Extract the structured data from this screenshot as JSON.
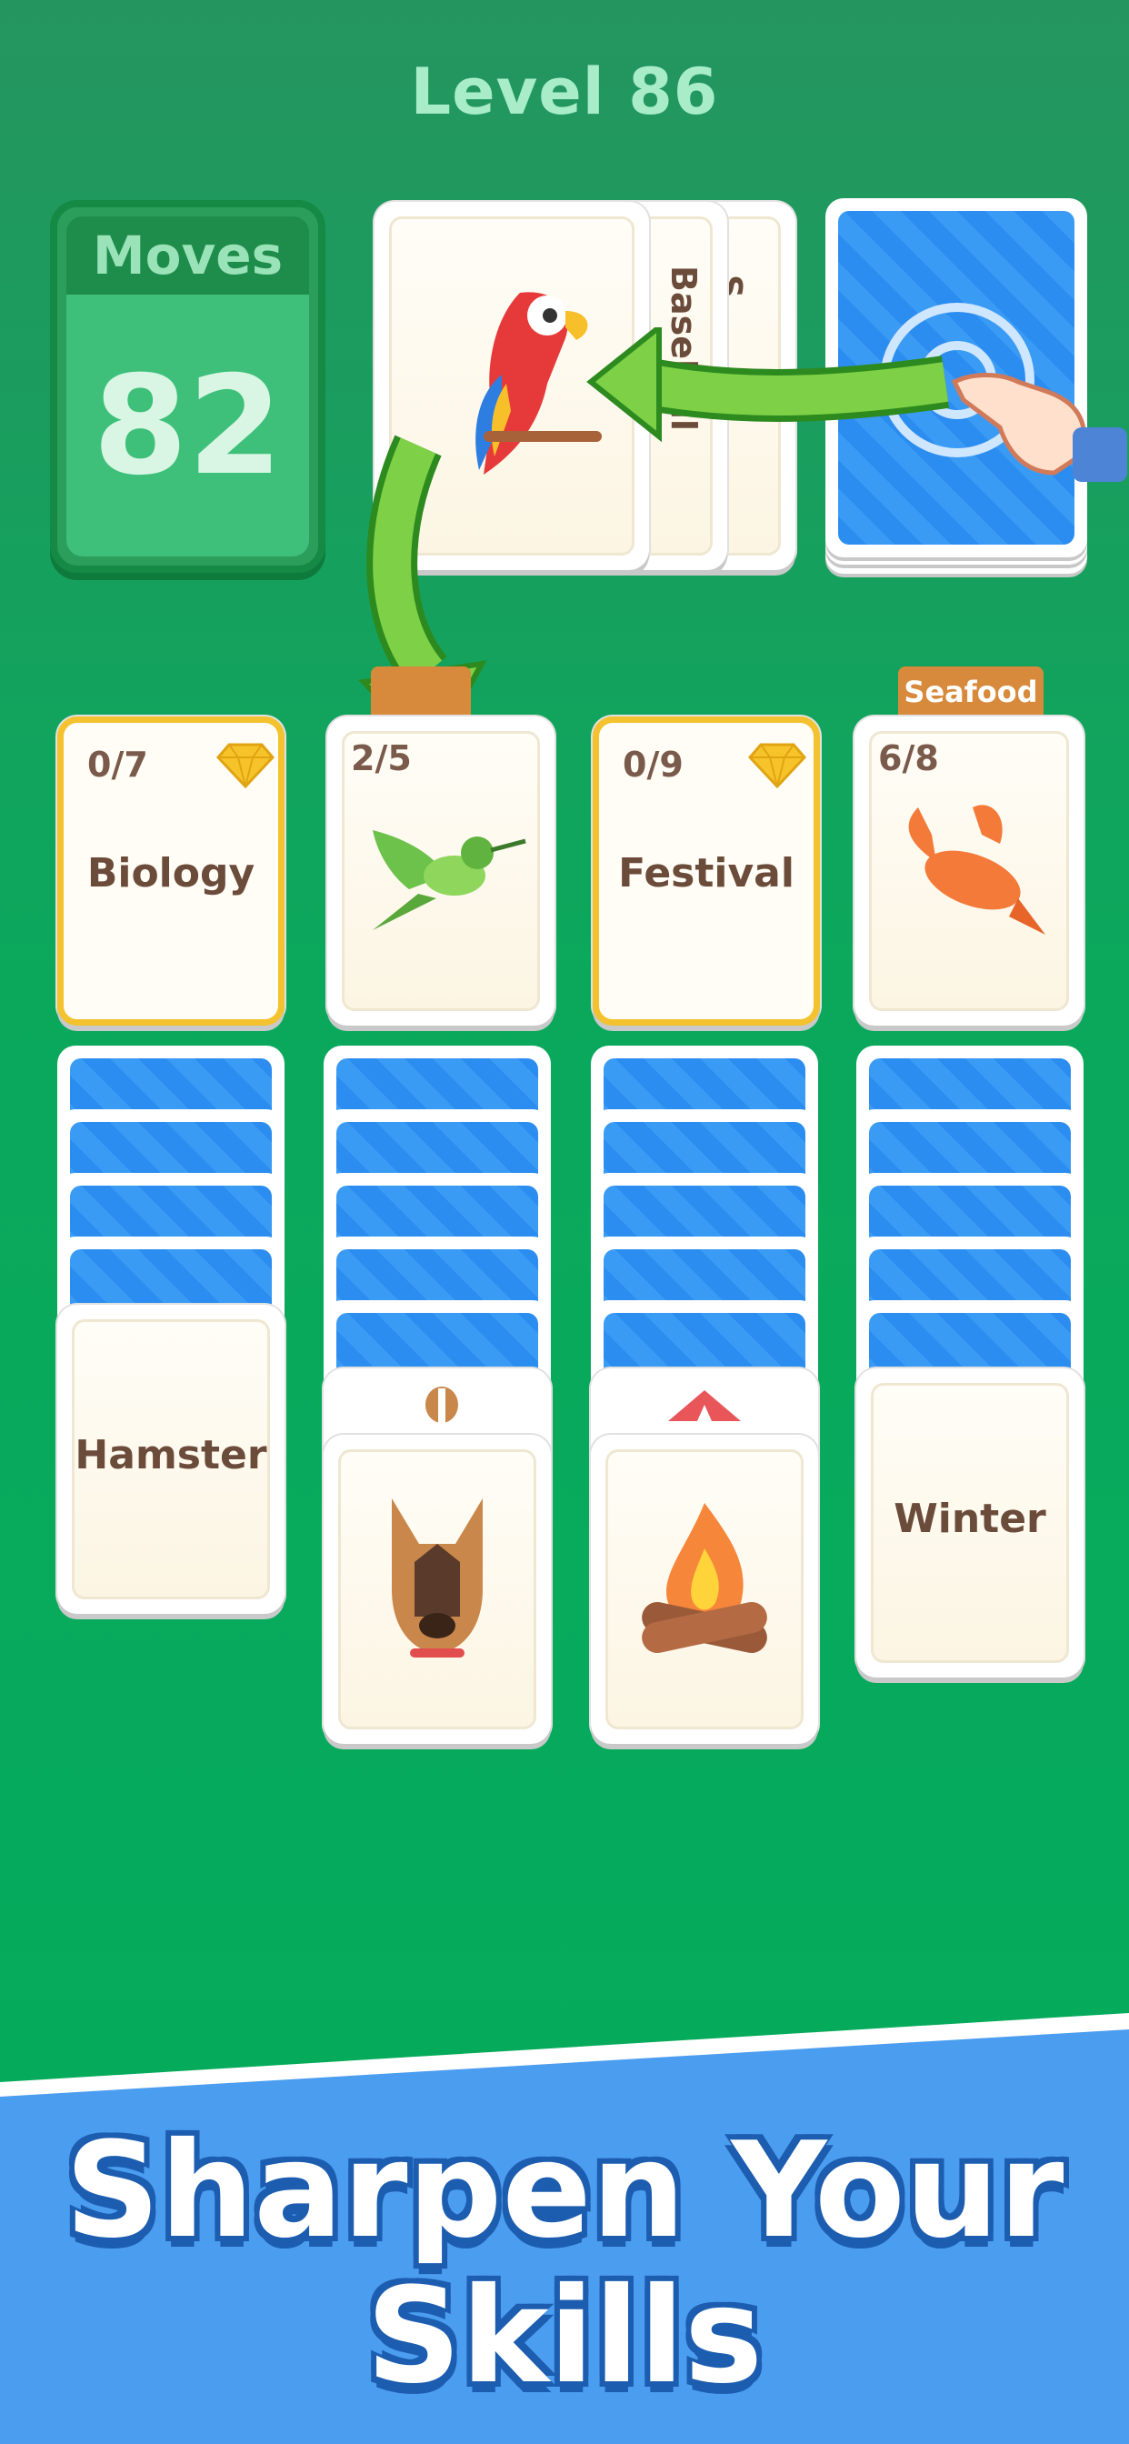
{
  "header": {
    "level_label": "Level 86"
  },
  "moves": {
    "label": "Moves",
    "value": "82"
  },
  "draw_pile": {
    "top_card_icon": "parrot-icon",
    "stacked_labels": [
      "Baseball",
      "S"
    ]
  },
  "deck": {
    "icon": "card-back-target-icon"
  },
  "foundations": [
    {
      "counter": "0/7",
      "title": "Biology",
      "type": "category",
      "gem": true
    },
    {
      "counter": "2/5",
      "icon": "hummingbird-icon",
      "type": "item",
      "gem": false
    },
    {
      "counter": "0/9",
      "title": "Festival",
      "type": "category",
      "gem": true
    },
    {
      "counter": "6/8",
      "icon": "lobster-icon",
      "type": "item",
      "tag": "Seafood",
      "gem": false
    }
  ],
  "tableau": [
    {
      "hidden": 4,
      "face_up": {
        "title": "Hamster"
      }
    },
    {
      "hidden": 5,
      "peek_icon": "beagle-icon",
      "face_up": {
        "icon": "german-shepherd-icon"
      }
    },
    {
      "hidden": 5,
      "peek_icon": "tent-icon",
      "face_up": {
        "icon": "campfire-icon"
      }
    },
    {
      "hidden": 5,
      "face_up": {
        "title": "Winter"
      }
    }
  ],
  "promo": {
    "line1": "Sharpen Your",
    "line2": "Skills"
  },
  "colors": {
    "background": "#03ac5b",
    "card_back": "#2b8df0",
    "gold_border": "#f3c22e",
    "banner": "#4b9df0"
  }
}
